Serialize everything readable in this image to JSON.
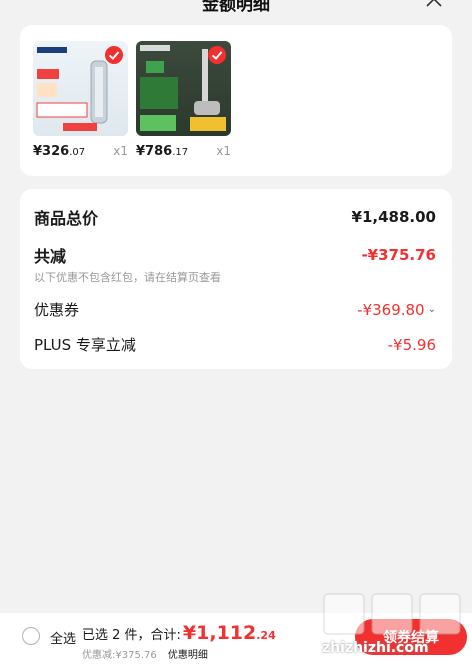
{
  "sheet": {
    "title": "金额明细"
  },
  "products": [
    {
      "price_main": "¥326",
      "price_decimal": ".07",
      "qty": "x1"
    },
    {
      "price_main": "¥786",
      "price_decimal": ".17",
      "qty": "x1"
    }
  ],
  "summary": {
    "goods_total_label": "商品总价",
    "goods_total_value": "¥1,488.00",
    "total_reduce_label": "共减",
    "total_reduce_value": "-¥375.76",
    "note": "以下优惠不包含红包，请在结算页查看",
    "coupon_label": "优惠券",
    "coupon_value": "-¥369.80",
    "plus_label": "PLUS 专享立减",
    "plus_value": "-¥5.96"
  },
  "bottom_bar": {
    "select_all": "全选",
    "selected_text": "已选 2 件，合计:",
    "total_main": "¥1,112",
    "total_decimal": ".24",
    "discount_text": "优惠减:¥375.76",
    "detail_link": "优惠明细",
    "checkout_label": "领券结算"
  },
  "watermark": {
    "text": "zhizhizhi.com"
  },
  "colors": {
    "accent": "#f23030",
    "background": "#f2f2f2",
    "card": "#ffffff"
  },
  "icons": {
    "close": "close-icon",
    "check": "check-icon",
    "chevron": "chevron-down-icon"
  }
}
